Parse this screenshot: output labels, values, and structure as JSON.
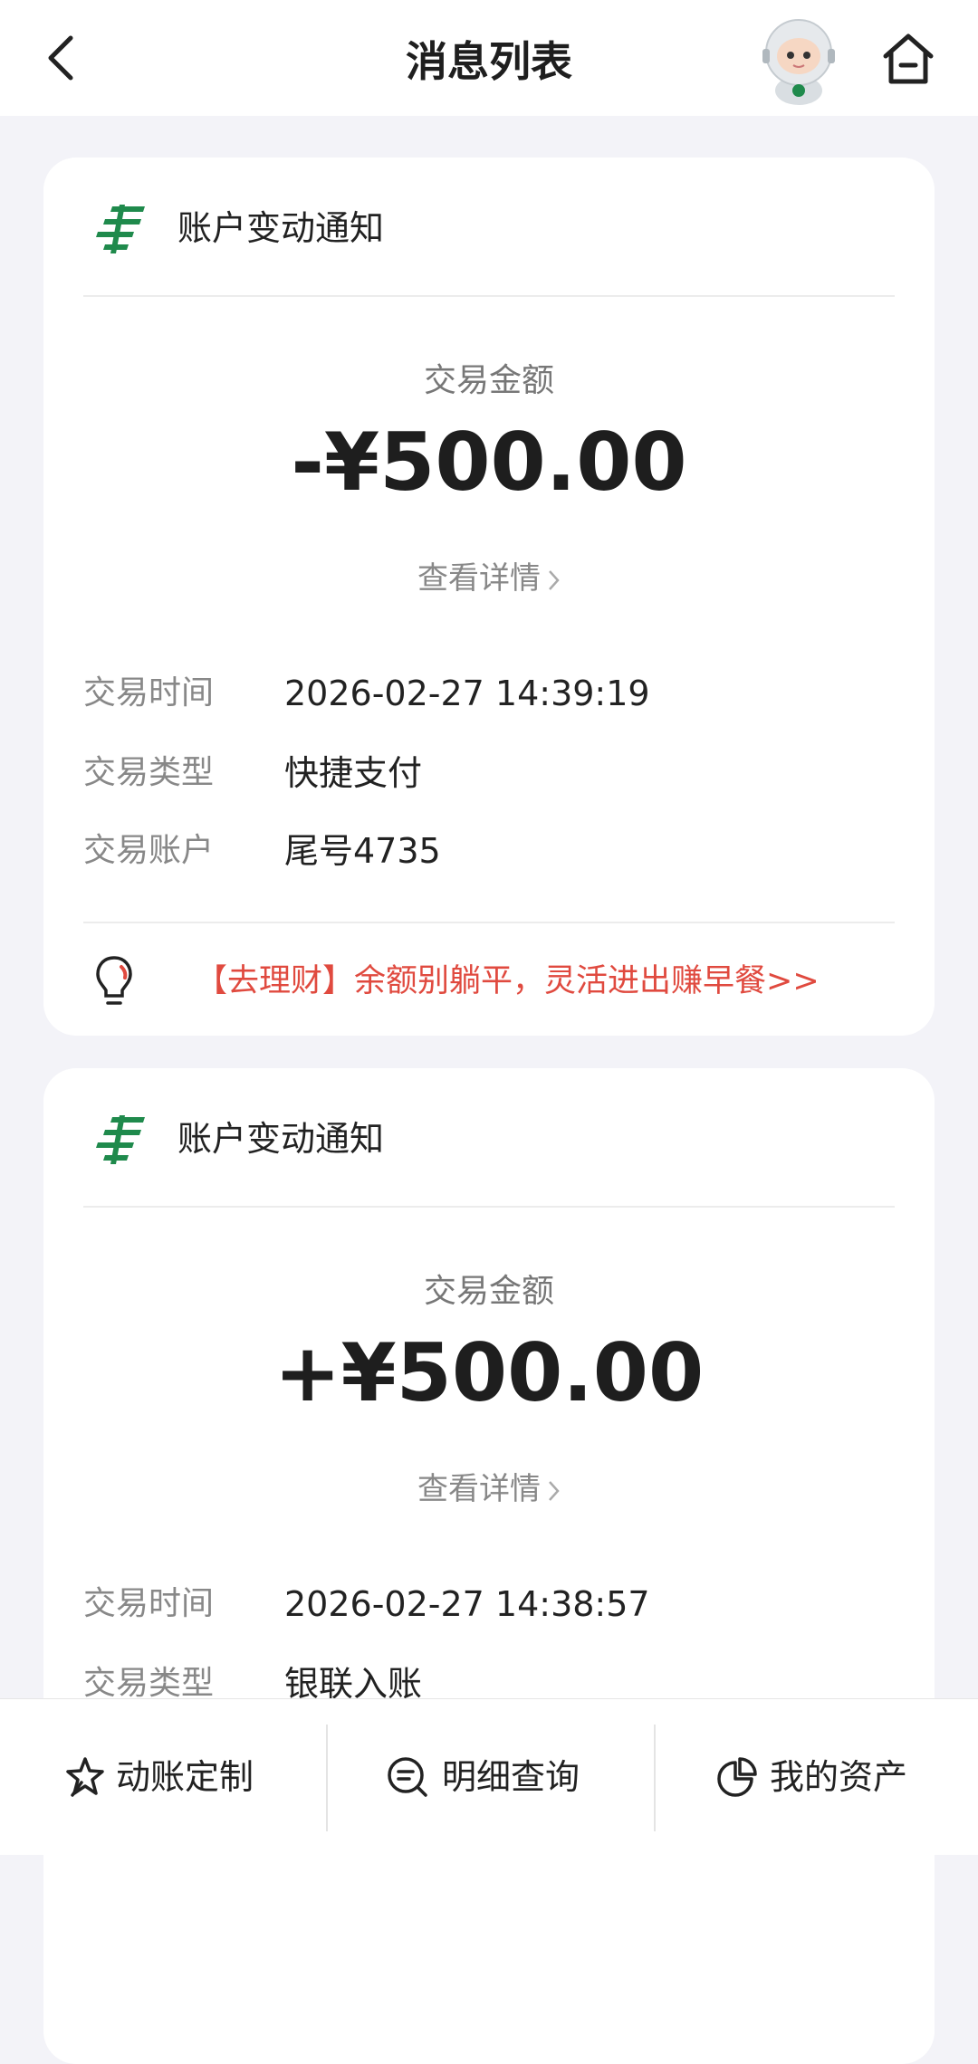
{
  "header": {
    "title": "消息列表",
    "back_icon": "chevron-left-icon",
    "assistant_icon": "robot-assistant-icon",
    "home_icon": "home-icon"
  },
  "colors": {
    "brand_green": "#1f8a4c",
    "promo_red": "#e04a3f",
    "page_bg": "#f3f3f8"
  },
  "messages": [
    {
      "title": "账户变动通知",
      "amount_label": "交易金额",
      "amount": "-¥500.00",
      "detail_link": "查看详情",
      "rows": [
        {
          "label": "交易时间",
          "value": "2026-02-27 14:39:19"
        },
        {
          "label": "交易类型",
          "value": "快捷支付"
        },
        {
          "label": "交易账户",
          "value": "尾号4735"
        }
      ],
      "promo": "【去理财】余额别躺平，灵活进出赚早餐>>"
    },
    {
      "title": "账户变动通知",
      "amount_label": "交易金额",
      "amount": "+¥500.00",
      "detail_link": "查看详情",
      "rows": [
        {
          "label": "交易时间",
          "value": "2026-02-27 14:38:57"
        },
        {
          "label": "交易类型",
          "value": "银联入账"
        }
      ]
    }
  ],
  "bottom_nav": [
    {
      "label": "动账定制",
      "icon": "star-badge-icon"
    },
    {
      "label": "明细查询",
      "icon": "search-list-icon"
    },
    {
      "label": "我的资产",
      "icon": "pie-chart-icon"
    }
  ]
}
